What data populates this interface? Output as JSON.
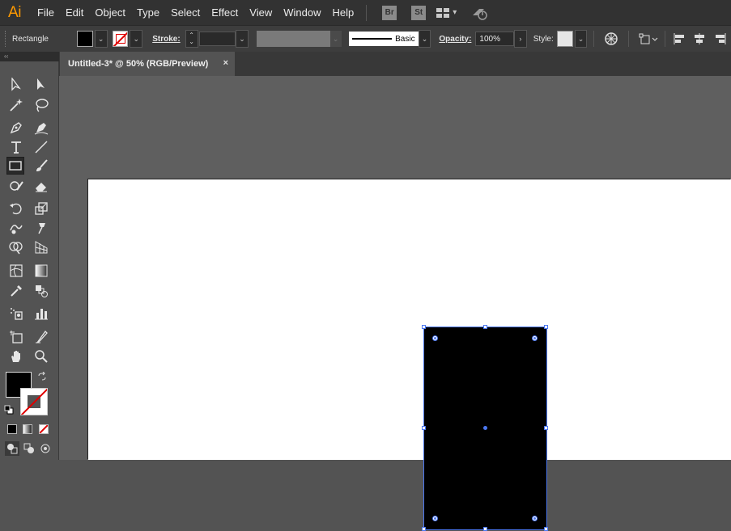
{
  "app": {
    "logo_text": "Ai",
    "accent": "#ff9a00"
  },
  "menu": {
    "items": [
      "File",
      "Edit",
      "Object",
      "Type",
      "Select",
      "Effect",
      "View",
      "Window",
      "Help"
    ],
    "bridge_label": "Br",
    "stock_label": "St"
  },
  "control_bar": {
    "tool_name": "Rectangle",
    "stroke_label": "Stroke:",
    "stroke_value": "",
    "brush_label": "Basic",
    "opacity_label": "Opacity:",
    "opacity_value": "100%",
    "style_label": "Style:",
    "fill_color": "#000000",
    "stroke_color": "none"
  },
  "document": {
    "tab_title": "Untitled-3* @ 50% (RGB/Preview)",
    "close_glyph": "×"
  },
  "toolbar": {
    "collapse_glyph": "‹‹",
    "selected_tool": "rectangle-tool"
  },
  "canvas": {
    "shape": "rectangle",
    "shape_fill": "#000000",
    "selection_color": "#4b77f0"
  }
}
